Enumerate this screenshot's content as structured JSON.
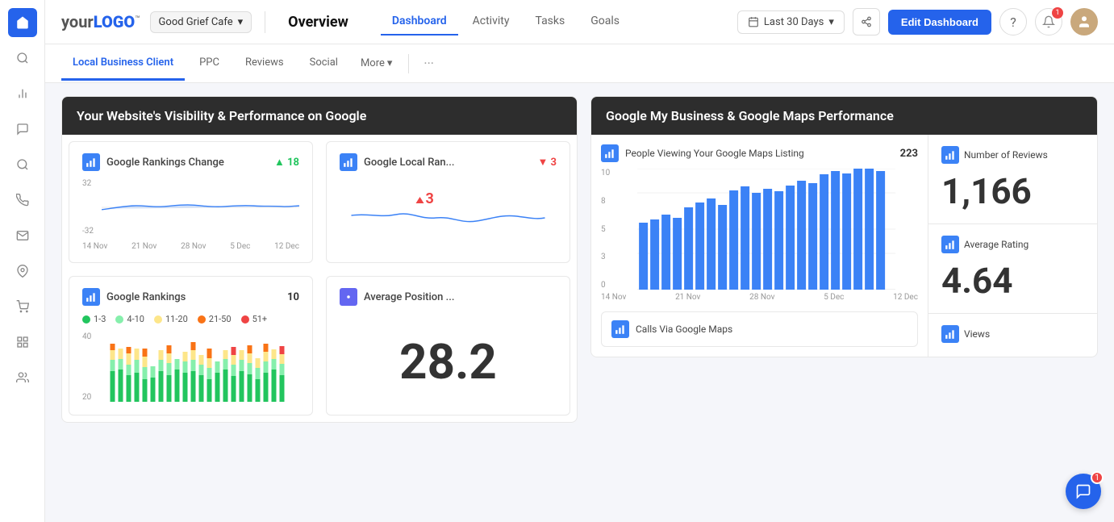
{
  "brand": {
    "logo_your": "your",
    "logo_logo": "LOGO",
    "logo_tm": "™"
  },
  "client_selector": {
    "label": "Good Grief Cafe",
    "chevron": "▾"
  },
  "top_nav": {
    "title": "Overview",
    "tabs": [
      {
        "label": "Dashboard",
        "active": true
      },
      {
        "label": "Activity"
      },
      {
        "label": "Tasks"
      },
      {
        "label": "Goals"
      }
    ],
    "date_range": "Last 30 Days",
    "edit_btn": "Edit Dashboard"
  },
  "icons": {
    "help": "?",
    "notification": "🔔",
    "share": "⤴",
    "calendar": "📅",
    "chevron": "▾",
    "dots": "···"
  },
  "notification_count": "1",
  "sub_nav": {
    "tabs": [
      {
        "label": "Local Business Client",
        "active": true
      },
      {
        "label": "PPC"
      },
      {
        "label": "Reviews"
      },
      {
        "label": "Social"
      },
      {
        "label": "More",
        "has_arrow": true
      }
    ]
  },
  "section_left": {
    "header": "Your Website's Visibility & Performance on Google",
    "cards": [
      {
        "id": "google-rankings-change",
        "icon": "bar-chart",
        "title": "Google Rankings Change",
        "badge": "18",
        "badge_prefix": "▲",
        "badge_color": "green",
        "y_top": "32",
        "y_bottom": "-32",
        "x_labels": [
          "14 Nov",
          "21 Nov",
          "28 Nov",
          "5 Dec",
          "12 Dec"
        ]
      },
      {
        "id": "google-local-rankings",
        "icon": "bar-chart",
        "title": "Google Local Ran...",
        "badge": "3",
        "badge_prefix": "▼",
        "badge_color": "red"
      },
      {
        "id": "google-rankings",
        "icon": "bar-chart",
        "title": "Google Rankings",
        "badge": "10",
        "legend": [
          {
            "label": "1-3",
            "color": "#22c55e"
          },
          {
            "label": "4-10",
            "color": "#86efac"
          },
          {
            "label": "11-20",
            "color": "#fde68a"
          },
          {
            "label": "21-50",
            "color": "#f97316"
          },
          {
            "label": "51+",
            "color": "#ef4444"
          }
        ],
        "y_label": "40",
        "y_label2": "20"
      },
      {
        "id": "average-position",
        "icon": "target",
        "title": "Average Position ...",
        "big_number": "28.2"
      }
    ]
  },
  "section_right": {
    "header": "Google My Business & Google Maps Performance",
    "gmb_chart": {
      "title": "People Viewing Your Google Maps Listing",
      "count": "223",
      "y_max": "10",
      "y_mid": "8",
      "y_low": "5",
      "y_min": "3",
      "y_zero": "0",
      "x_labels": [
        "14 Nov",
        "21 Nov",
        "28 Nov",
        "5 Dec",
        "12 Dec"
      ],
      "bars": [
        5.5,
        5.8,
        6.2,
        5.9,
        6.8,
        7.2,
        7.5,
        7.0,
        8.2,
        8.5,
        8.0,
        8.3,
        8.1,
        8.6,
        9.0,
        8.8,
        9.5,
        9.8,
        9.6,
        10.0,
        10.0,
        9.8
      ]
    },
    "stats": [
      {
        "title": "Number of Reviews",
        "icon": "bar-chart",
        "value": "1,166"
      },
      {
        "title": "Average Rating",
        "icon": "bar-chart",
        "value": "4.64"
      },
      {
        "title": "Calls Via Google Maps",
        "icon": "bar-chart"
      },
      {
        "title": "Views",
        "icon": "bar-chart"
      }
    ]
  },
  "chat": {
    "badge": "1"
  }
}
